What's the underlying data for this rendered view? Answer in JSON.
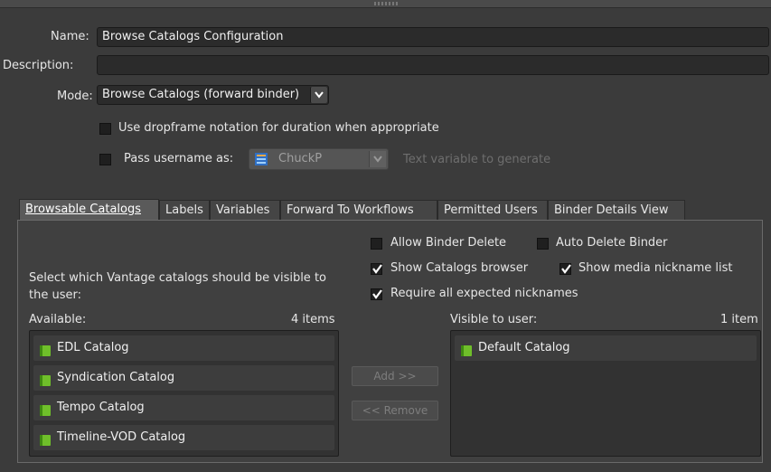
{
  "form": {
    "name_label": "Name:",
    "name_value": "Browse Catalogs Configuration",
    "description_label": "Description:",
    "description_value": "",
    "mode_label": "Mode:",
    "mode_value": "Browse Catalogs (forward binder)",
    "dropframe_label": "Use dropframe notation for duration when appropriate",
    "dropframe_checked": false,
    "pass_username_label": "Pass username as:",
    "pass_username_checked": false,
    "pass_username_value": "ChuckP",
    "pass_username_hint": "Text variable to generate"
  },
  "tabs": [
    {
      "label": "Browsable Catalogs",
      "active": true
    },
    {
      "label": "Labels",
      "active": false
    },
    {
      "label": "Variables",
      "active": false
    },
    {
      "label": "Forward To Workflows",
      "active": false
    },
    {
      "label": "Permitted Users",
      "active": false
    },
    {
      "label": "Binder Details View",
      "active": false
    }
  ],
  "panel": {
    "options": [
      {
        "label": "Allow Binder Delete",
        "checked": false
      },
      {
        "label": "Auto Delete Binder",
        "checked": false
      },
      {
        "label": "Show Catalogs browser",
        "checked": true
      },
      {
        "label": "Show media nickname list",
        "checked": true
      },
      {
        "label": "Require all expected nicknames",
        "checked": true
      }
    ],
    "description": "Select which Vantage catalogs should be visible to the user:",
    "available_label": "Available:",
    "available_count": "4 items",
    "available_items": [
      "EDL Catalog",
      "Syndication Catalog",
      "Tempo Catalog",
      "Timeline-VOD Catalog"
    ],
    "visible_label": "Visible to user:",
    "visible_count": "1 item",
    "visible_items": [
      "Default Catalog"
    ],
    "add_button": "Add >>",
    "remove_button": "<< Remove"
  },
  "colors": {
    "background": "#3b3b3b",
    "field": "#2b2b2b",
    "catalog_icon": "#6fbf2a"
  }
}
